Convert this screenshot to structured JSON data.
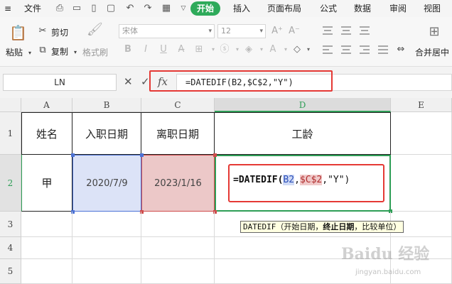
{
  "menu": {
    "file": "文件",
    "tabs": [
      "开始",
      "插入",
      "页面布局",
      "公式",
      "数据",
      "审阅",
      "视图"
    ]
  },
  "ribbon": {
    "paste": "粘贴",
    "cut": "剪切",
    "copy": "复制",
    "format_painter": "格式刷",
    "font_name": "宋体",
    "font_size": "12",
    "merge_center": "合并居中"
  },
  "formula_bar": {
    "name_box": "LN",
    "fx": "fx",
    "formula": "=DATEDIF(B2,$C$2,\"Y\")"
  },
  "columns": [
    "A",
    "B",
    "C",
    "D",
    "E"
  ],
  "rows": [
    "1",
    "2",
    "3",
    "4",
    "5"
  ],
  "header_row": {
    "a": "姓名",
    "b": "入职日期",
    "c": "离职日期",
    "d": "工龄"
  },
  "data_row": {
    "a": "甲",
    "b": "2020/7/9",
    "c": "2023/1/16"
  },
  "editing_formula": {
    "func": "=DATEDIF(",
    "ref1": "B2",
    "sep1": ",",
    "ref2": "$C$2",
    "sep2": ",",
    "arg3": "\"Y\")"
  },
  "tooltip": {
    "func": "DATEDIF",
    "open": "（开始日期，",
    "current_arg": "终止日期",
    "rest": "，比较单位）"
  },
  "watermark": {
    "logo": "Baidu 经验",
    "site": "jingyan.baidu.com"
  }
}
